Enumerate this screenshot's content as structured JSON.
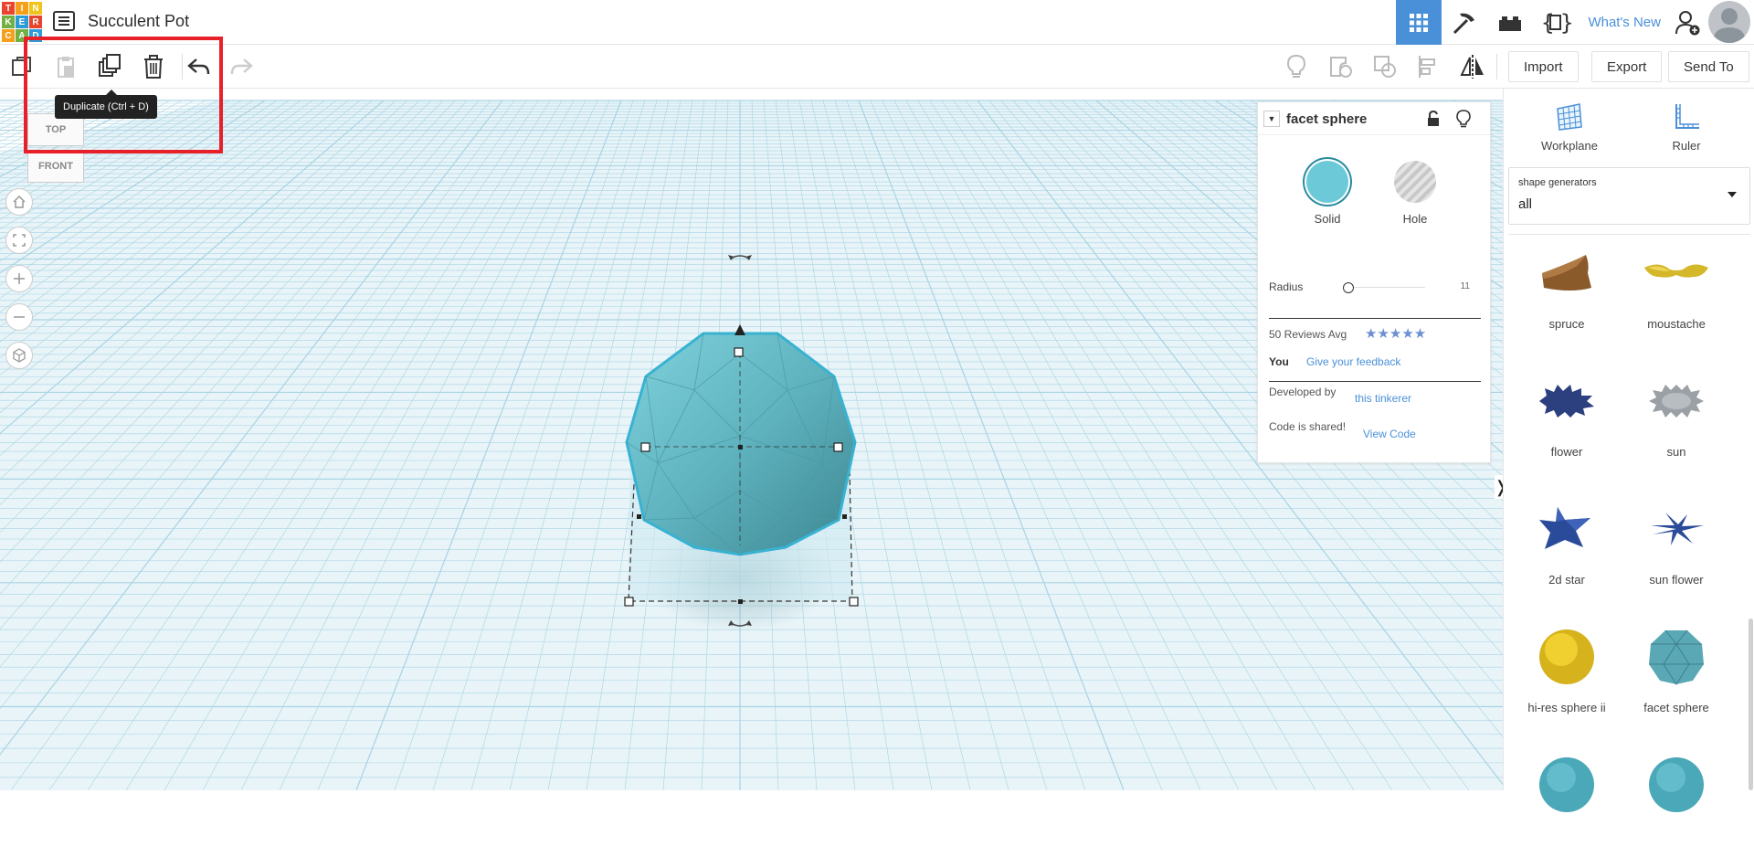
{
  "app": {
    "logo_letters": [
      "T",
      "I",
      "N",
      "K",
      "E",
      "R",
      "C",
      "A",
      "D"
    ],
    "logo_colors": [
      "#e8442e",
      "#f59f1b",
      "#f0c419",
      "#72b043",
      "#2d9bd7",
      "#e8442e",
      "#f59f1b",
      "#72b043",
      "#2d9bd7"
    ],
    "project_title": "Succulent Pot"
  },
  "top_nav": {
    "whats_new": "What's New"
  },
  "toolbar": {
    "tooltip": "Duplicate (Ctrl + D)",
    "import_label": "Import",
    "export_label": "Export",
    "send_to_label": "Send To"
  },
  "viewcube": {
    "top": "TOP",
    "front": "FRONT"
  },
  "inspector": {
    "title": "facet sphere",
    "solid_label": "Solid",
    "hole_label": "Hole",
    "solid_color": "#6ccad8",
    "radius_label": "Radius",
    "radius_value": "11",
    "reviews_label": "50 Reviews Avg",
    "stars": "★★★★★",
    "you_label": "You",
    "feedback_link": "Give your feedback",
    "developed_label": "Developed by",
    "developer_link": "this tinkerer",
    "code_label": "Code is shared!",
    "code_link": "View Code"
  },
  "right_panel": {
    "workplane_label": "Workplane",
    "ruler_label": "Ruler",
    "generator_label": "shape generators",
    "generator_value": "all",
    "shapes": [
      {
        "name": "spruce",
        "color": "#8b5a2b"
      },
      {
        "name": "moustache",
        "color": "#d4b82a"
      },
      {
        "name": "flower",
        "color": "#2c3f7f"
      },
      {
        "name": "sun",
        "color": "#9aa0a6"
      },
      {
        "name": "2d star",
        "color": "#2a4a9a"
      },
      {
        "name": "sun flower",
        "color": "#2a4a9a"
      },
      {
        "name": "hi-res sphere ii",
        "color": "#e0c020"
      },
      {
        "name": "facet sphere",
        "color": "#5aa8b5"
      },
      {
        "name": "",
        "color": "#4aa8b8"
      },
      {
        "name": "",
        "color": "#4aa8b8"
      }
    ]
  }
}
